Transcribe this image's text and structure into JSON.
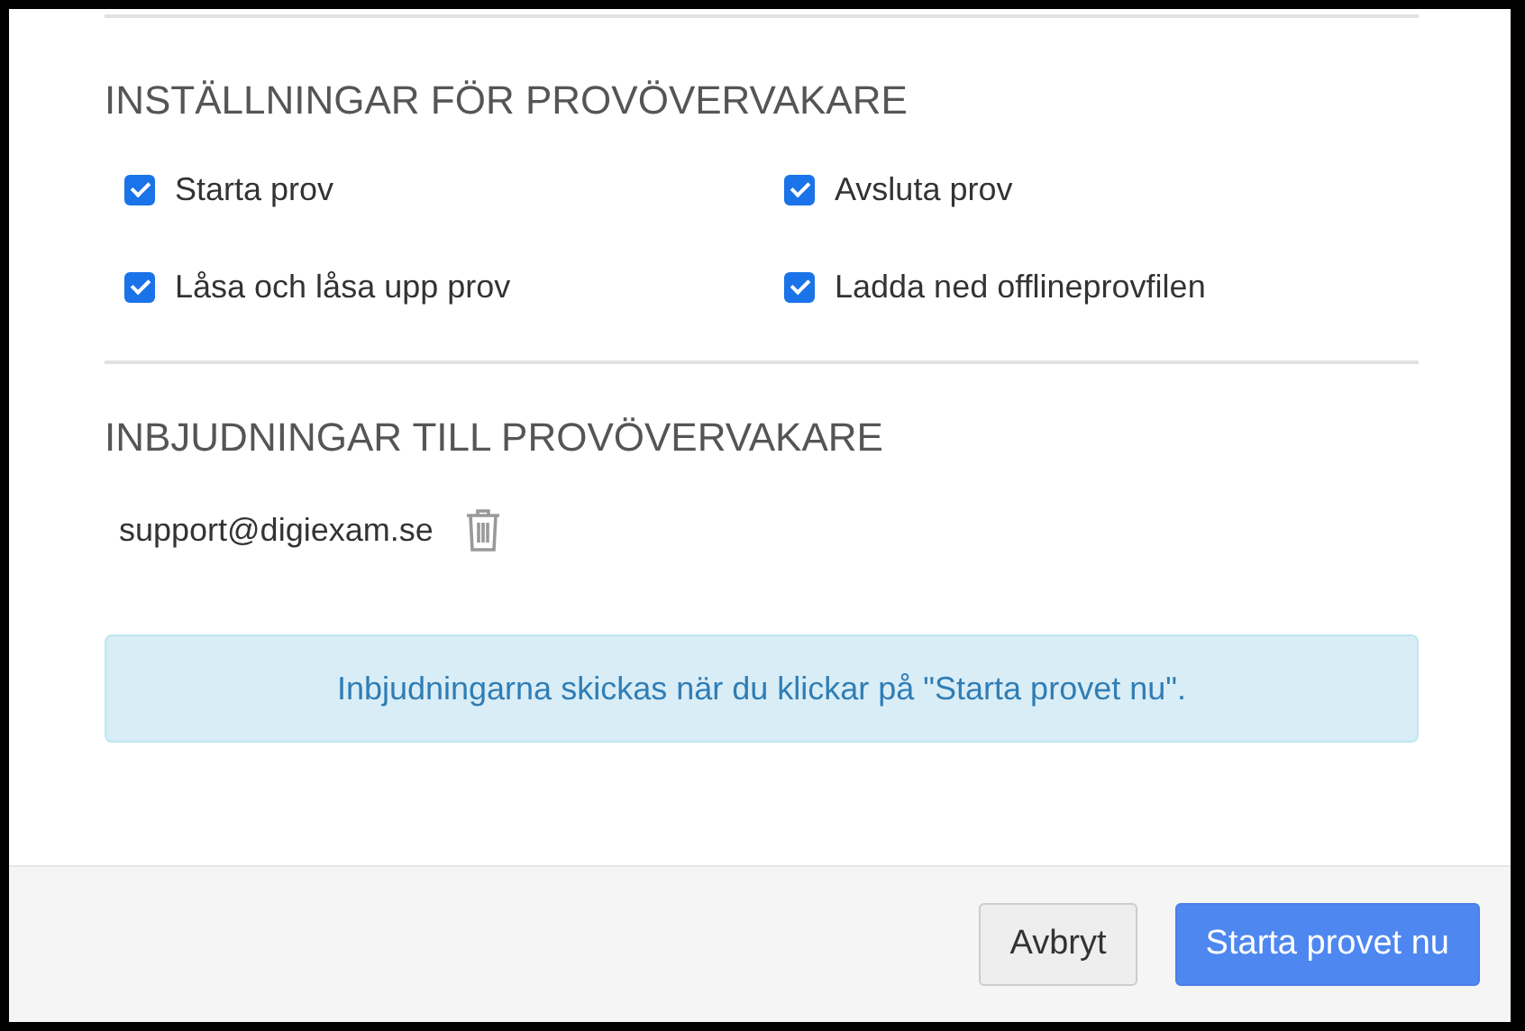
{
  "proctor_settings": {
    "heading": "INSTÄLLNINGAR FÖR PROVÖVERVAKARE",
    "options": [
      {
        "label": "Starta prov",
        "checked": true
      },
      {
        "label": "Avsluta prov",
        "checked": true
      },
      {
        "label": "Låsa och låsa upp prov",
        "checked": true
      },
      {
        "label": "Ladda ned offlineprovfilen",
        "checked": true
      }
    ]
  },
  "invitations": {
    "heading": "INBJUDNINGAR TILL PROVÖVERVAKARE",
    "emails": [
      "support@digiexam.se"
    ],
    "notice": "Inbjudningarna skickas när du klickar på \"Starta provet nu\"."
  },
  "buttons": [
    {
      "label": "Avbryt",
      "kind": "secondary"
    },
    {
      "label": "Starta provet nu",
      "kind": "primary"
    }
  ]
}
